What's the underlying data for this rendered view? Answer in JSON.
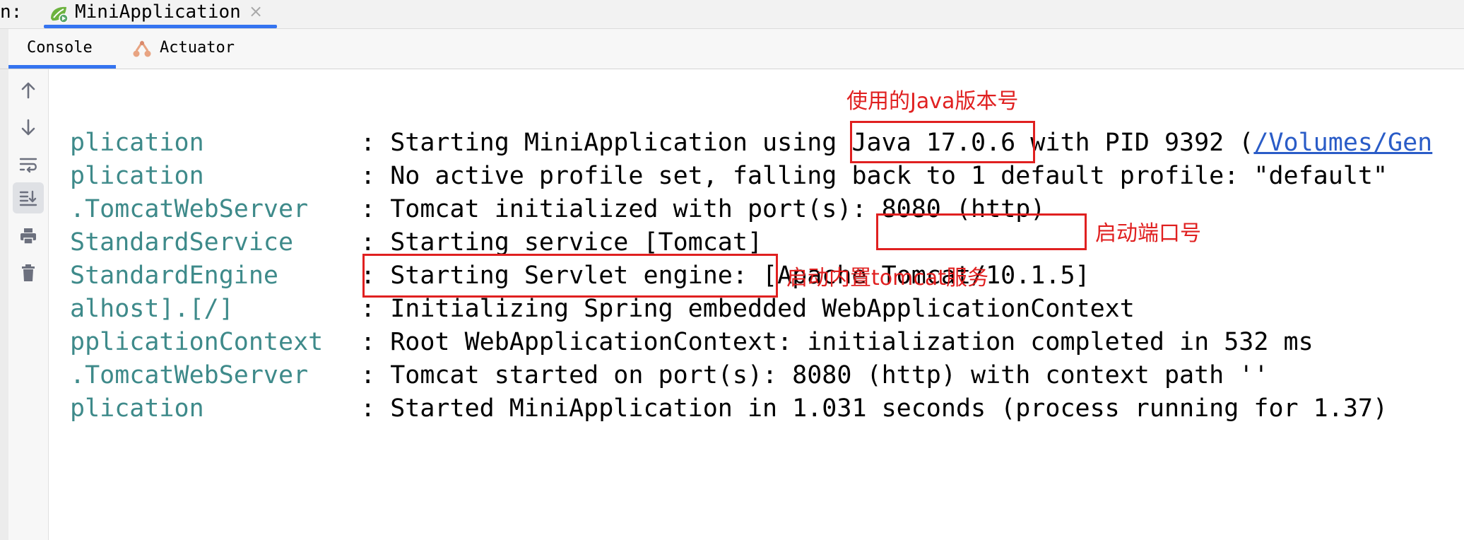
{
  "titlebar": {
    "run_label": "n:",
    "tab_title": "MiniApplication",
    "close_glyph": "×"
  },
  "subtabs": {
    "console": "Console",
    "actuator": "Actuator"
  },
  "toolbar": {
    "buttons": [
      "arrow-up-icon",
      "arrow-down-icon",
      "soft-wrap-icon",
      "scroll-to-end-icon",
      "print-icon",
      "trash-icon"
    ]
  },
  "console": {
    "lines": [
      {
        "logger": "plication",
        "message": "Starting MiniApplication using Java 17.0.6 with PID 9392 (",
        "link": "/Volumes/Gen"
      },
      {
        "logger": "plication",
        "message": "No active profile set, falling back to 1 default profile: \"default\""
      },
      {
        "logger": ".TomcatWebServer",
        "message": "Tomcat initialized with port(s): 8080 (http)"
      },
      {
        "logger": "StandardService",
        "message": "Starting service [Tomcat]"
      },
      {
        "logger": "StandardEngine",
        "message": "Starting Servlet engine: [Apache Tomcat/10.1.5]"
      },
      {
        "logger": "alhost].[/]",
        "message": "Initializing Spring embedded WebApplicationContext"
      },
      {
        "logger": "pplicationContext",
        "message": "Root WebApplicationContext: initialization completed in 532 ms"
      },
      {
        "logger": ".TomcatWebServer",
        "message": "Tomcat started on port(s): 8080 (http) with context path ''"
      },
      {
        "logger": "plication",
        "message": "Started MiniApplication in 1.031 seconds (process running for 1.37)"
      }
    ],
    "separator": " : "
  },
  "annotations": {
    "java_version": "使用的Java版本号",
    "port": "启动端口号",
    "tomcat": "启动内置tomcat服务"
  },
  "colors": {
    "accent": "#3574f0",
    "logger": "#3e8a8a",
    "annotation": "#e02020",
    "link": "#2a5cc7"
  }
}
